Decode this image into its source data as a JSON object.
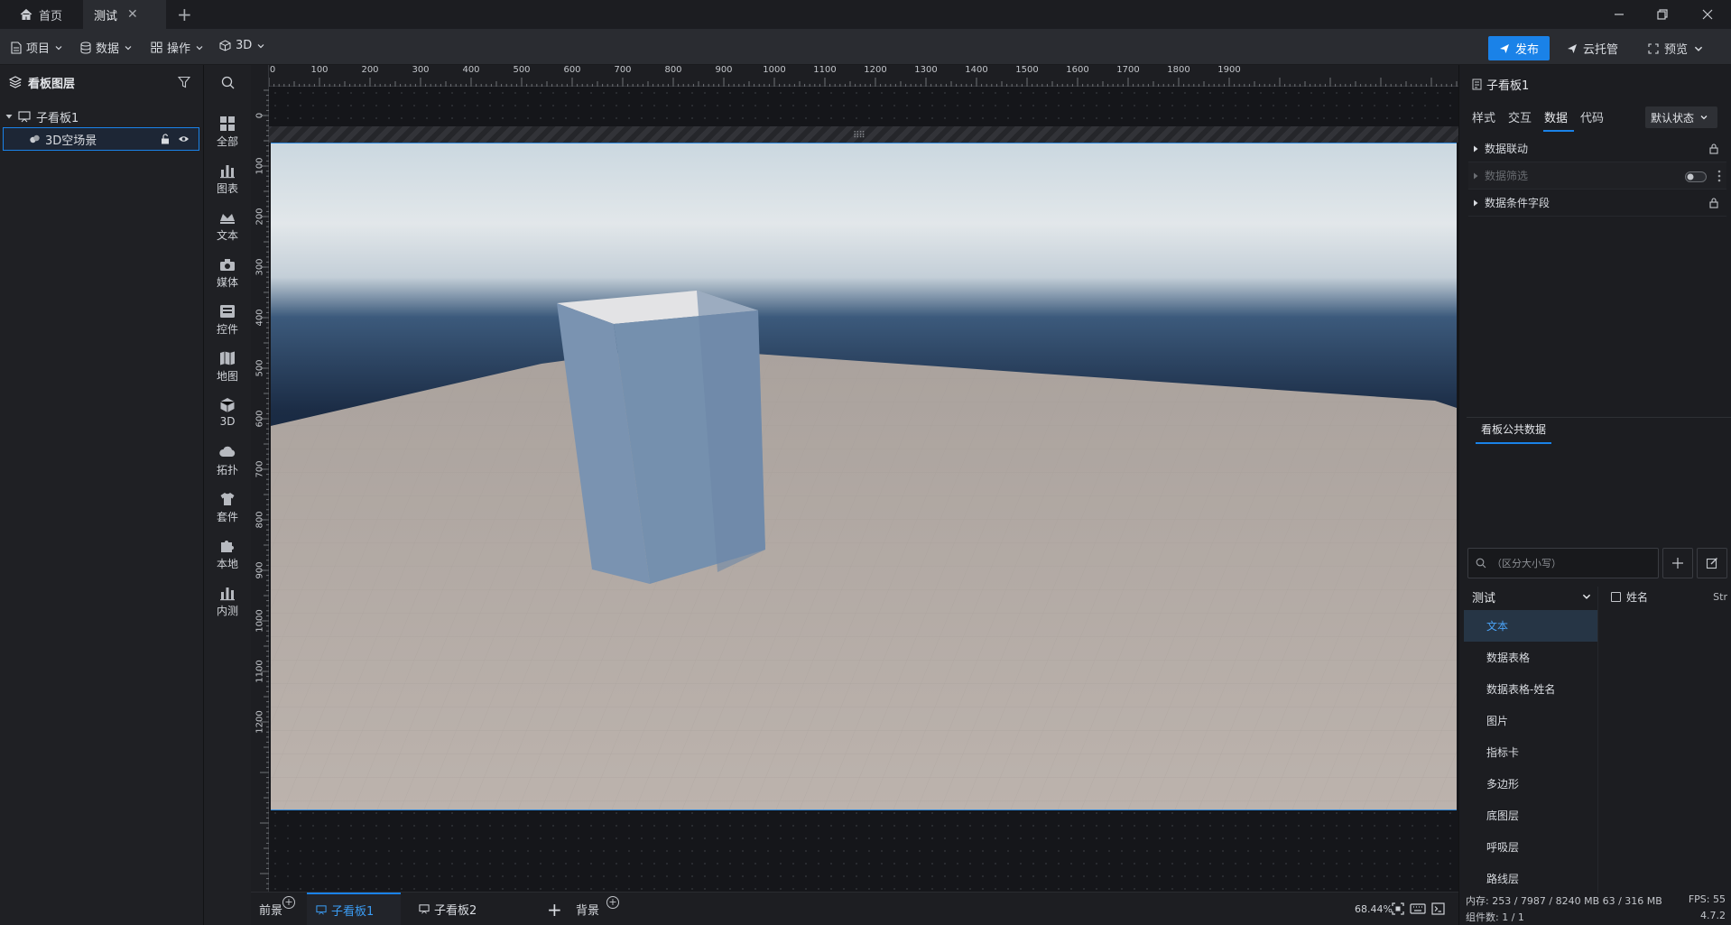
{
  "tabs": {
    "home": "首页",
    "active": "测试"
  },
  "menu": {
    "project": "项目",
    "data": "数据",
    "operation": "操作",
    "threed": "3D",
    "publish": "发布",
    "cloud": "云托管",
    "preview": "预览"
  },
  "layers": {
    "title": "看板图层",
    "parent": "子看板1",
    "child": "3D空场景"
  },
  "components": [
    "全部",
    "图表",
    "文本",
    "媒体",
    "控件",
    "地图",
    "3D",
    "拓扑",
    "套件",
    "本地",
    "内测"
  ],
  "ruler": {
    "top": [
      "0",
      "100",
      "200",
      "300",
      "400",
      "500",
      "600",
      "700",
      "800",
      "900",
      "1000",
      "1100",
      "1200",
      "1300",
      "1400",
      "1500",
      "1600",
      "1700",
      "1800",
      "1900"
    ],
    "left": [
      "0",
      "100",
      "200",
      "300",
      "400",
      "500",
      "600",
      "700",
      "800",
      "900",
      "1000",
      "1100",
      "1200"
    ]
  },
  "scenes": {
    "front": "前景",
    "board1": "子看板1",
    "board2": "子看板2",
    "background": "背景",
    "zoom": "68.44%"
  },
  "props": {
    "title": "子看板1",
    "tabs": [
      "样式",
      "交互",
      "数据",
      "代码"
    ],
    "active_tab": "数据",
    "state": "默认状态",
    "rows": [
      "数据联动",
      "数据筛选",
      "数据条件字段"
    ],
    "public_data_title": "看板公共数据",
    "search_placeholder": "（区分大小写）",
    "group": "测试",
    "items": [
      "文本",
      "数据表格",
      "数据表格-姓名",
      "图片",
      "指标卡",
      "多边形",
      "底图层",
      "呼吸层",
      "路线层"
    ],
    "field_name": "姓名",
    "field_type": "Str"
  },
  "status": {
    "memory": "内存:  253 / 7987 / 8240 MB  63 / 316 MB",
    "fps": "FPS: 55",
    "count": "组件数: 1 / 1",
    "version": "4.7.2"
  },
  "colors": {
    "accent": "#1a82e8",
    "box": "#7590ae",
    "floor": "#b9b1ab"
  }
}
